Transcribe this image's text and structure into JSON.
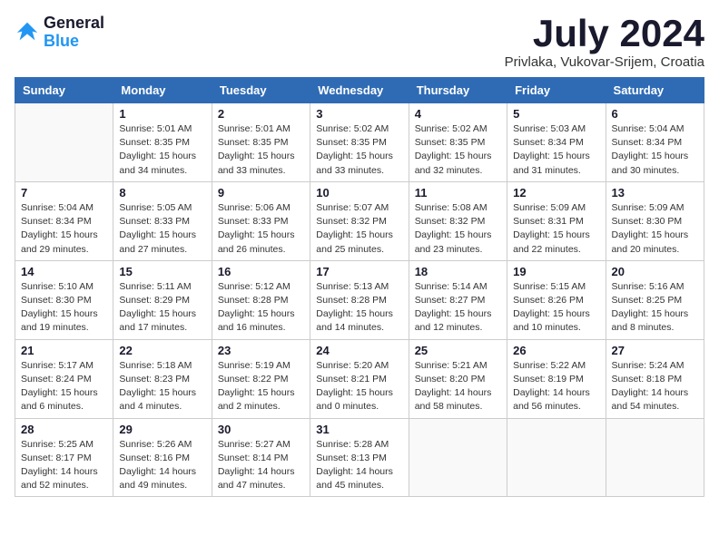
{
  "logo": {
    "line1": "General",
    "line2": "Blue"
  },
  "title": "July 2024",
  "location": "Privlaka, Vukovar-Srijem, Croatia",
  "headers": [
    "Sunday",
    "Monday",
    "Tuesday",
    "Wednesday",
    "Thursday",
    "Friday",
    "Saturday"
  ],
  "weeks": [
    [
      {
        "day": "",
        "info": ""
      },
      {
        "day": "1",
        "info": "Sunrise: 5:01 AM\nSunset: 8:35 PM\nDaylight: 15 hours\nand 34 minutes."
      },
      {
        "day": "2",
        "info": "Sunrise: 5:01 AM\nSunset: 8:35 PM\nDaylight: 15 hours\nand 33 minutes."
      },
      {
        "day": "3",
        "info": "Sunrise: 5:02 AM\nSunset: 8:35 PM\nDaylight: 15 hours\nand 33 minutes."
      },
      {
        "day": "4",
        "info": "Sunrise: 5:02 AM\nSunset: 8:35 PM\nDaylight: 15 hours\nand 32 minutes."
      },
      {
        "day": "5",
        "info": "Sunrise: 5:03 AM\nSunset: 8:34 PM\nDaylight: 15 hours\nand 31 minutes."
      },
      {
        "day": "6",
        "info": "Sunrise: 5:04 AM\nSunset: 8:34 PM\nDaylight: 15 hours\nand 30 minutes."
      }
    ],
    [
      {
        "day": "7",
        "info": "Sunrise: 5:04 AM\nSunset: 8:34 PM\nDaylight: 15 hours\nand 29 minutes."
      },
      {
        "day": "8",
        "info": "Sunrise: 5:05 AM\nSunset: 8:33 PM\nDaylight: 15 hours\nand 27 minutes."
      },
      {
        "day": "9",
        "info": "Sunrise: 5:06 AM\nSunset: 8:33 PM\nDaylight: 15 hours\nand 26 minutes."
      },
      {
        "day": "10",
        "info": "Sunrise: 5:07 AM\nSunset: 8:32 PM\nDaylight: 15 hours\nand 25 minutes."
      },
      {
        "day": "11",
        "info": "Sunrise: 5:08 AM\nSunset: 8:32 PM\nDaylight: 15 hours\nand 23 minutes."
      },
      {
        "day": "12",
        "info": "Sunrise: 5:09 AM\nSunset: 8:31 PM\nDaylight: 15 hours\nand 22 minutes."
      },
      {
        "day": "13",
        "info": "Sunrise: 5:09 AM\nSunset: 8:30 PM\nDaylight: 15 hours\nand 20 minutes."
      }
    ],
    [
      {
        "day": "14",
        "info": "Sunrise: 5:10 AM\nSunset: 8:30 PM\nDaylight: 15 hours\nand 19 minutes."
      },
      {
        "day": "15",
        "info": "Sunrise: 5:11 AM\nSunset: 8:29 PM\nDaylight: 15 hours\nand 17 minutes."
      },
      {
        "day": "16",
        "info": "Sunrise: 5:12 AM\nSunset: 8:28 PM\nDaylight: 15 hours\nand 16 minutes."
      },
      {
        "day": "17",
        "info": "Sunrise: 5:13 AM\nSunset: 8:28 PM\nDaylight: 15 hours\nand 14 minutes."
      },
      {
        "day": "18",
        "info": "Sunrise: 5:14 AM\nSunset: 8:27 PM\nDaylight: 15 hours\nand 12 minutes."
      },
      {
        "day": "19",
        "info": "Sunrise: 5:15 AM\nSunset: 8:26 PM\nDaylight: 15 hours\nand 10 minutes."
      },
      {
        "day": "20",
        "info": "Sunrise: 5:16 AM\nSunset: 8:25 PM\nDaylight: 15 hours\nand 8 minutes."
      }
    ],
    [
      {
        "day": "21",
        "info": "Sunrise: 5:17 AM\nSunset: 8:24 PM\nDaylight: 15 hours\nand 6 minutes."
      },
      {
        "day": "22",
        "info": "Sunrise: 5:18 AM\nSunset: 8:23 PM\nDaylight: 15 hours\nand 4 minutes."
      },
      {
        "day": "23",
        "info": "Sunrise: 5:19 AM\nSunset: 8:22 PM\nDaylight: 15 hours\nand 2 minutes."
      },
      {
        "day": "24",
        "info": "Sunrise: 5:20 AM\nSunset: 8:21 PM\nDaylight: 15 hours\nand 0 minutes."
      },
      {
        "day": "25",
        "info": "Sunrise: 5:21 AM\nSunset: 8:20 PM\nDaylight: 14 hours\nand 58 minutes."
      },
      {
        "day": "26",
        "info": "Sunrise: 5:22 AM\nSunset: 8:19 PM\nDaylight: 14 hours\nand 56 minutes."
      },
      {
        "day": "27",
        "info": "Sunrise: 5:24 AM\nSunset: 8:18 PM\nDaylight: 14 hours\nand 54 minutes."
      }
    ],
    [
      {
        "day": "28",
        "info": "Sunrise: 5:25 AM\nSunset: 8:17 PM\nDaylight: 14 hours\nand 52 minutes."
      },
      {
        "day": "29",
        "info": "Sunrise: 5:26 AM\nSunset: 8:16 PM\nDaylight: 14 hours\nand 49 minutes."
      },
      {
        "day": "30",
        "info": "Sunrise: 5:27 AM\nSunset: 8:14 PM\nDaylight: 14 hours\nand 47 minutes."
      },
      {
        "day": "31",
        "info": "Sunrise: 5:28 AM\nSunset: 8:13 PM\nDaylight: 14 hours\nand 45 minutes."
      },
      {
        "day": "",
        "info": ""
      },
      {
        "day": "",
        "info": ""
      },
      {
        "day": "",
        "info": ""
      }
    ]
  ]
}
